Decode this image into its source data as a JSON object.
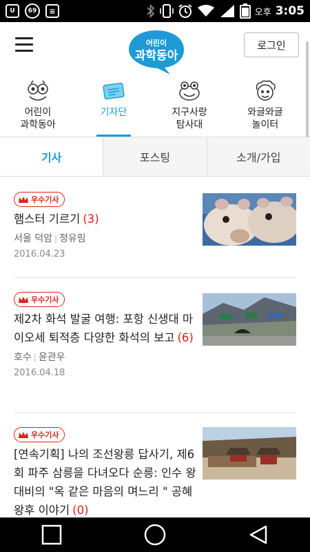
{
  "status_bar": {
    "ampm": "오후",
    "time": "3:05",
    "notification_count": "69",
    "icons": [
      "notification-box-icon",
      "notification-count-icon",
      "list-icon",
      "bluetooth-icon",
      "vibrate-icon",
      "alarm-icon",
      "wifi-icon",
      "signal-icon",
      "battery-icon"
    ]
  },
  "header": {
    "logo_top": "어린이",
    "logo_main": "과학동아",
    "login_label": "로그인"
  },
  "categories": [
    {
      "label": "어린이\n과학동아",
      "icon": "science-owl-icon"
    },
    {
      "label": "기자단",
      "icon": "reporter-card-icon"
    },
    {
      "label": "지구사랑\n탐사대",
      "icon": "frog-icon"
    },
    {
      "label": "와글와글\n놀이터",
      "icon": "curly-kid-icon"
    }
  ],
  "subtabs": [
    "기사",
    "포스팅",
    "소개/가입"
  ],
  "articles": [
    {
      "badge": "우수기사",
      "title": "햄스터 기르기",
      "count": "(3)",
      "school": "서울 덕암",
      "author": "정유림",
      "date": "2016.04.23",
      "thumb": "hamster-photo"
    },
    {
      "badge": "우수기사",
      "title": "제2차 화석 발굴 여행: 포항 신생대 마이오세 퇴적층 다양한 화석의 보고",
      "count": "(6)",
      "school": "호수",
      "author": "윤관우",
      "date": "2016.04.18",
      "thumb": "highway-tunnel-photo"
    },
    {
      "badge": "우수기사",
      "title": "[연속기획] 나의 조선왕릉 답사기, 제6회 파주 삼릉을 다녀오다 순릉: 인수 왕대비의 \"옥 같은 마음의 며느리 \" 공혜왕후 이야기",
      "count": "(0)",
      "school": "",
      "author": "",
      "date": "",
      "thumb": "royal-tomb-photo"
    }
  ],
  "navbar": [
    "recent-apps-icon",
    "home-icon",
    "back-icon"
  ],
  "colors": {
    "accent": "#1a9dd6",
    "badge": "#d9261c",
    "logo": "#1e9ad6"
  }
}
